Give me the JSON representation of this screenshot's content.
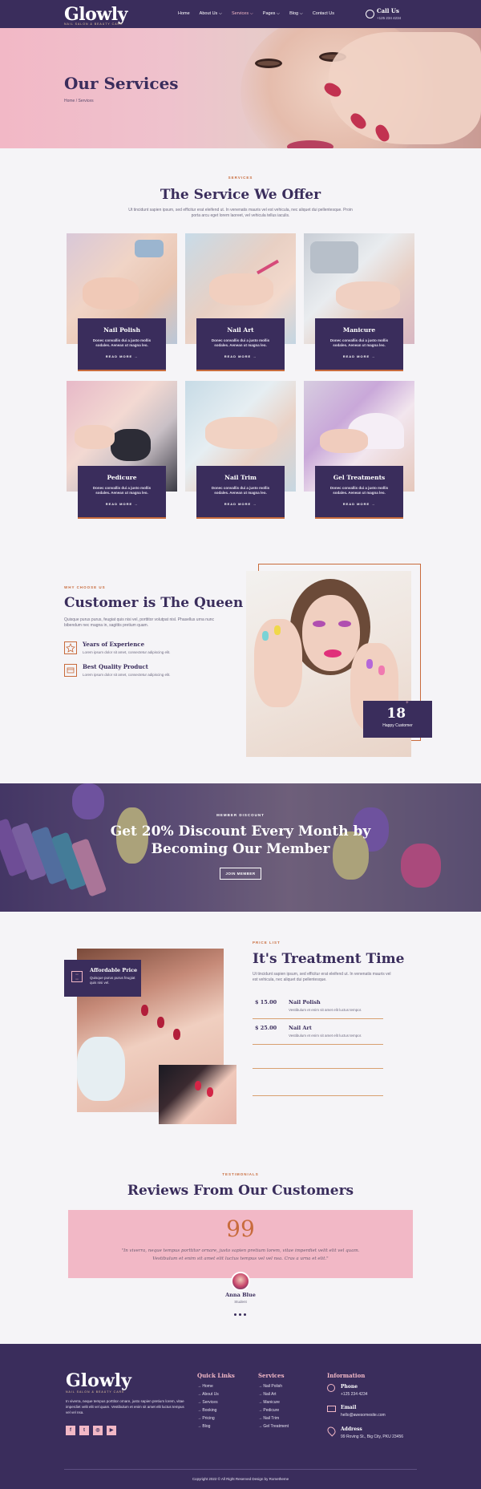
{
  "header": {
    "logo": "Glowly",
    "logo_sub": "NAIL SALON & BEAUTY CARE",
    "nav": [
      "Home",
      "About Us ⌵",
      "Services ⌵",
      "Pages ⌵",
      "Blog ⌵",
      "Contact Us"
    ],
    "call_title": "Call Us",
    "call_number": "+125 234 4234",
    "phone_icon": "phone-icon"
  },
  "hero": {
    "title": "Our Services",
    "breadcrumb": "Home / Services"
  },
  "services": {
    "eyebrow": "SERVICES",
    "title": "The Service We Offer",
    "intro": "Ut tincidunt sapien ipsum, sed efficitur erat eleifend ut. In venenatis mauris vel est vehicula, nec aliquet dui pellentesque. Proin porta arcu eget lorem laoreet, vel vehicula tellus iaculis.",
    "cards": [
      {
        "title": "Nail Polish",
        "desc": "Donec convallis dui a justo mollis sodales. Aenean ut magna leo.",
        "link": "READ MORE →"
      },
      {
        "title": "Nail Art",
        "desc": "Donec convallis dui a justo mollis sodales. Aenean ut magna leo.",
        "link": "READ MORE →"
      },
      {
        "title": "Manicure",
        "desc": "Donec convallis dui a justo mollis sodales. Aenean ut magna leo.",
        "link": "READ MORE →"
      },
      {
        "title": "Pedicure",
        "desc": "Donec convallis dui a justo mollis sodales. Aenean ut magna leo.",
        "link": "READ MORE →"
      },
      {
        "title": "Nail Trim",
        "desc": "Donec convallis dui a justo mollis sodales. Aenean ut magna leo.",
        "link": "READ MORE →"
      },
      {
        "title": "Gel Treatments",
        "desc": "Donec convallis dui a justo mollis sodales. Aenean ut magna leo.",
        "link": "READ MORE →"
      }
    ]
  },
  "why": {
    "eyebrow": "WHY CHOOSE US",
    "title": "Customer is The Queen",
    "text": "Quisque purus purus, feugiat quis nisi vel, porttitor volutpat nisl. Phasellus urna nunc bibendum nec magna in, sagittis pretium quam.",
    "features": [
      {
        "title": "Years of Experience",
        "desc": "Lorem ipsum dolor sit amet, consectetur adipiscing elit.",
        "icon": "star-badge-icon"
      },
      {
        "title": "Best Quality Product",
        "desc": "Lorem ipsum dolor sit amet, consectetur adipiscing elit.",
        "icon": "product-box-icon"
      }
    ],
    "stat_number": "18",
    "stat_plus": "+",
    "stat_label": "Happy Customer"
  },
  "discount": {
    "eyebrow": "MEMBER DISCOUNT",
    "title_line1": "Get 20% Discount Every Month by",
    "title_line2": "Becoming Our Member",
    "button": "JOIN MEMBER"
  },
  "price": {
    "badge_icon": "price-tag-icon",
    "badge_title": "Affordable Price",
    "badge_desc": "Quisque purus purus feugiat quis nisi vel.",
    "eyebrow": "PRICE LIST",
    "title": "It's Treatment Time",
    "text": "Ut tincidunt sapien ipsum, sed efficitur erat eleifend ut. In venenatis mauris vel est vehicula, nec aliquet dui pellentesque.",
    "items": [
      {
        "price": "$ 15.00",
        "name": "Nail Polish",
        "desc": "Vestibulum et enim sit amet elit luctus tempor."
      },
      {
        "price": "$ 25.00",
        "name": "Nail Art",
        "desc": "Vestibulum et enim sit amet elit luctus tempor."
      }
    ]
  },
  "testimonials": {
    "eyebrow": "TESTIMONIALS",
    "title": "Reviews From Our Customers",
    "quote_mark": "99",
    "quote_line1": "\"In viverra, neque tempus porttitor ornare, justo sapien pretium lorem, vitae imperdiet velit elit vel quam.",
    "quote_line2": "Vestibulum et enim sit amet elit luctus tempus vel vel nsa. Cras a urna et elit.\"",
    "name": "Anna Blue",
    "role": "Student"
  },
  "footer": {
    "logo": "Glowly",
    "logo_sub": "NAIL SALON & BEAUTY CARE",
    "about": "In viverra, neque tempus porttitor ornare, justo sapien pretium lorem, vitae imperdiet velit elit vel quam. Vestibulum et enim sit amet elit luctus tempus vel vel nsa.",
    "social": [
      "f",
      "t",
      "◎",
      "▶"
    ],
    "quick_title": "Quick Links",
    "quick_links": [
      "Home",
      "About Us",
      "Services",
      "Booking",
      "Pricing",
      "Blog"
    ],
    "services_title": "Services",
    "services_links": [
      "Nail Polish",
      "Nail Art",
      "Manicure",
      "Pedicure",
      "Nail Trim",
      "Gel Treatment"
    ],
    "info_title": "Information",
    "phone_label": "Phone",
    "phone": "+125 234 4234",
    "email_label": "Email",
    "email": "hello@awesomesite.com",
    "address_label": "Address",
    "address": "99 Roving St., Big City, PKU 23456",
    "copyright": "Copyright 2022 © All Right Reserved Design by Rometheme"
  },
  "colors": {
    "primary": "#3a2d5c",
    "pink": "#f2b8c6",
    "accent": "#c86b3c"
  }
}
